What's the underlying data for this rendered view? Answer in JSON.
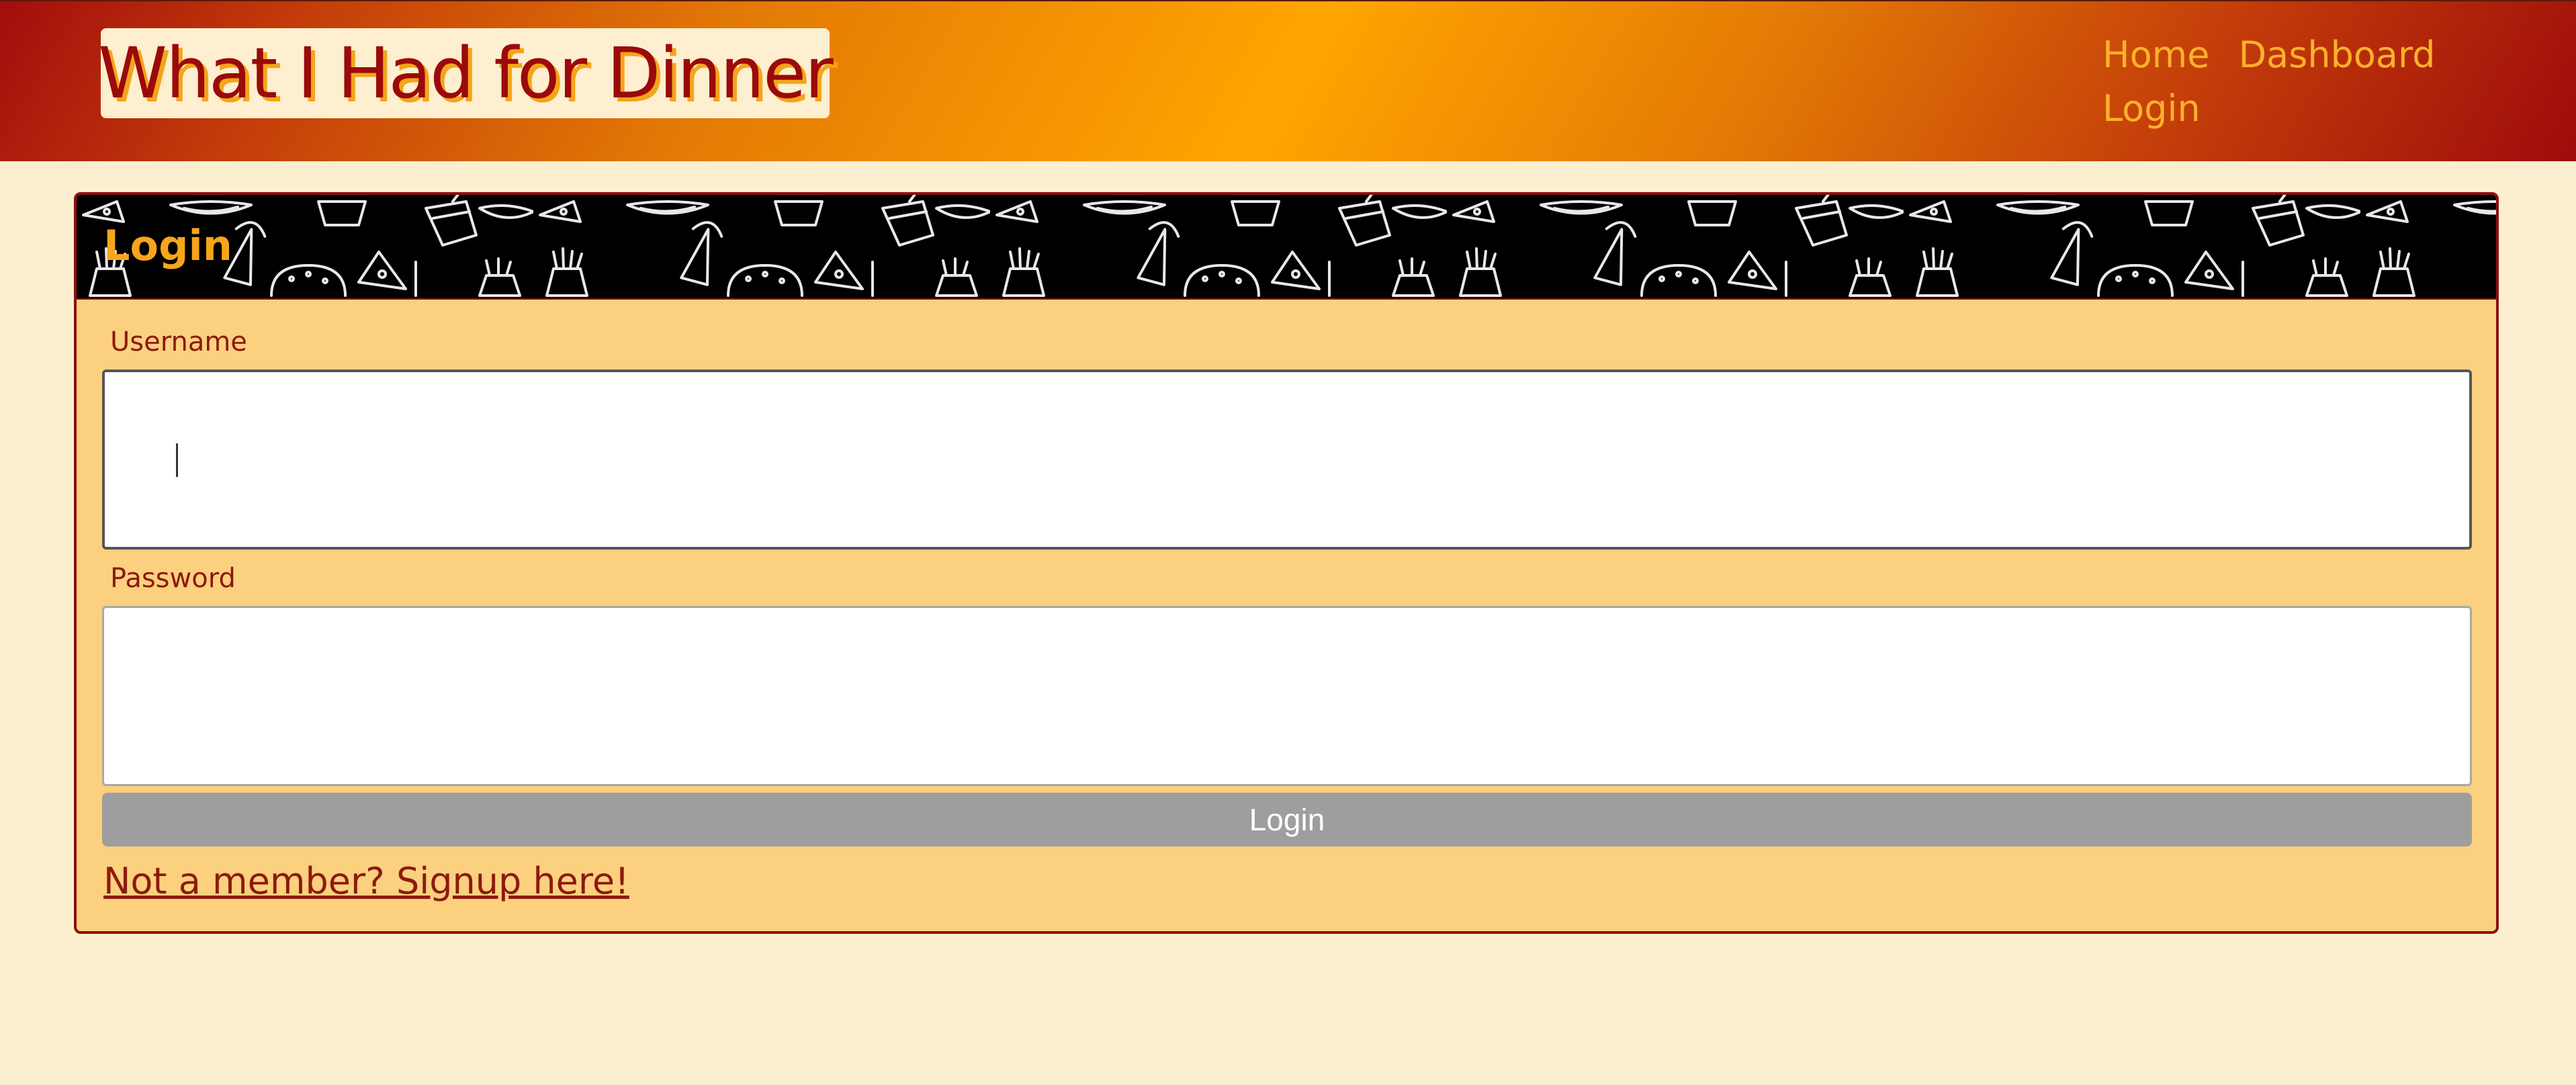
{
  "header": {
    "brand_title": "What I Had for Dinner",
    "nav": [
      {
        "label": "Home"
      },
      {
        "label": "Dashboard"
      },
      {
        "label": "Login"
      }
    ]
  },
  "login_card": {
    "title": "Login",
    "username": {
      "label": "Username",
      "value": "",
      "placeholder": ""
    },
    "password": {
      "label": "Password",
      "value": "",
      "placeholder": ""
    },
    "submit_label": "Login",
    "signup_link": "Not a member? Signup here!"
  },
  "colors": {
    "page_background": "#fbefcf",
    "header_gradient": [
      "#a30d0d",
      "#ffa500",
      "#9e0b0b"
    ],
    "card_background": "#fbd07e",
    "card_border": "#8c0f0f",
    "nav_link": "#fcb12b",
    "title_text": "#9b0a0a",
    "title_shadow": "#f3a51a",
    "button_background": "#9e9e9e"
  },
  "icons": {
    "card_header_pattern": "food-doodle-pattern"
  }
}
